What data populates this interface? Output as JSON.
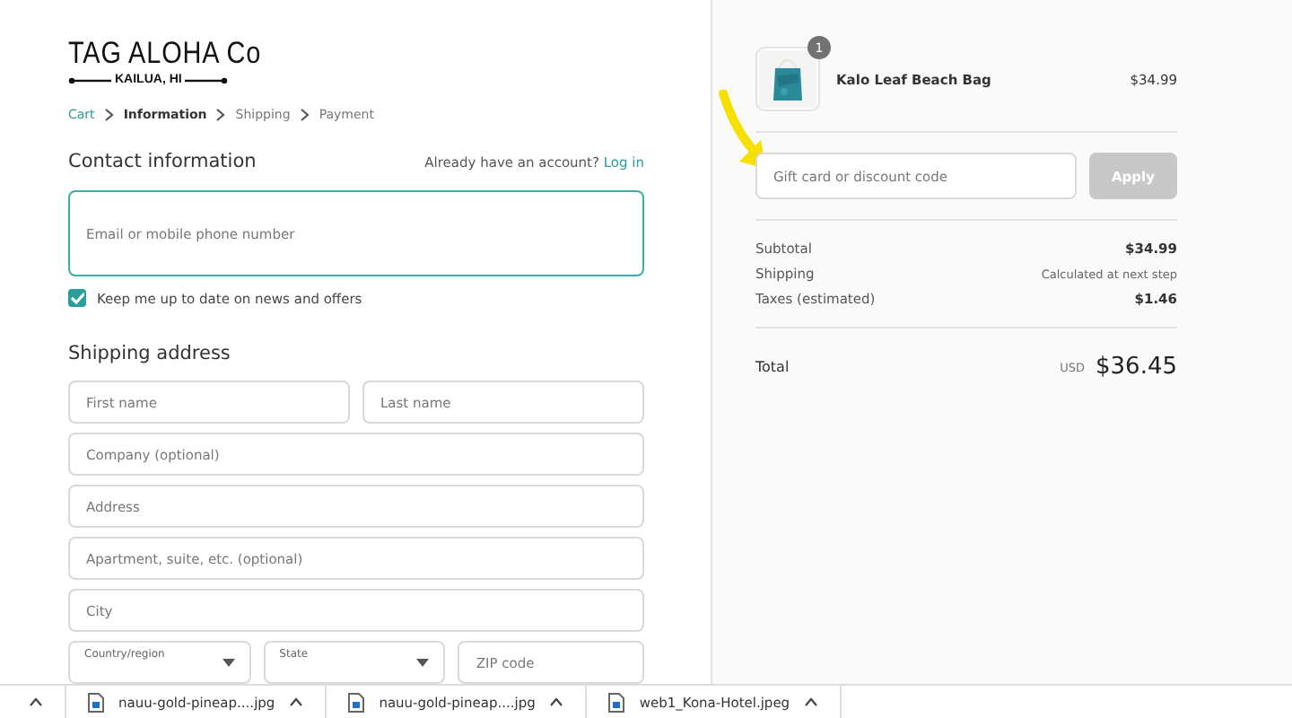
{
  "logo": {
    "name": "TAG ALOHA Co",
    "place": "KAILUA, HI"
  },
  "breadcrumb": [
    {
      "label": "Cart",
      "kind": "link"
    },
    {
      "label": "Information",
      "kind": "current"
    },
    {
      "label": "Shipping",
      "kind": "step"
    },
    {
      "label": "Payment",
      "kind": "step"
    }
  ],
  "contact": {
    "title": "Contact information",
    "account_prompt": "Already have an account?",
    "login": "Log in",
    "email": {
      "placeholder": "Email or mobile phone number"
    },
    "newsletter": {
      "label": "Keep me up to date on news and offers",
      "checked": true
    }
  },
  "shipping": {
    "title": "Shipping address",
    "rows": [
      [
        {
          "placeholder": "First name"
        },
        {
          "placeholder": "Last name"
        }
      ],
      [
        {
          "placeholder": "Company (optional)"
        }
      ],
      [
        {
          "placeholder": "Address"
        }
      ],
      [
        {
          "placeholder": "Apartment, suite, etc. (optional)"
        }
      ],
      [
        {
          "placeholder": "City"
        }
      ],
      [
        {
          "label": "Country/region",
          "kind": "select"
        },
        {
          "label": "State",
          "kind": "select"
        },
        {
          "placeholder": "ZIP code",
          "kind": "input"
        }
      ]
    ]
  },
  "order": {
    "items": [
      {
        "name": "Kalo Leaf Beach Bag",
        "price": "$34.99",
        "quantity": "1"
      }
    ],
    "discount": {
      "placeholder": "Gift card or discount code",
      "button": "Apply",
      "disabled": true
    },
    "lines": [
      {
        "label": "Subtotal",
        "value": "$34.99",
        "kind": "amount"
      },
      {
        "label": "Shipping",
        "value": "Calculated at next step",
        "kind": "note"
      },
      {
        "label": "Taxes (estimated)",
        "value": "$1.46",
        "kind": "amount"
      }
    ],
    "total": {
      "label": "Total",
      "currency": "USD",
      "value": "$36.45"
    }
  },
  "downloads": [
    {
      "name": "nauu-gold-pineap....jpg"
    },
    {
      "name": "nauu-gold-pineap....jpg"
    },
    {
      "name": "web1_Kona-Hotel.jpeg"
    }
  ]
}
